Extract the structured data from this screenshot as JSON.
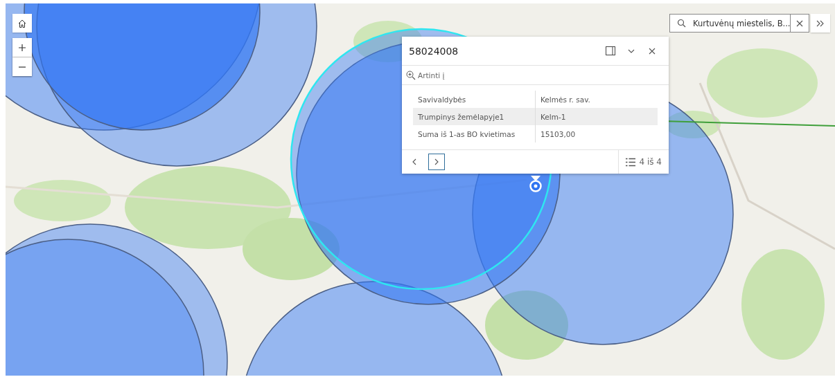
{
  "search": {
    "value": "Kurtuvėnų miestelis, B..."
  },
  "popup": {
    "title": "58024008",
    "action": "Artinti į",
    "fields": [
      {
        "label": "Savivaldybės",
        "value": "Kelmės r. sav.",
        "highlighted": false
      },
      {
        "label": "Trumpinys žemėlapyje1",
        "value": "Kelm-1",
        "highlighted": true
      },
      {
        "label": "Suma iš 1-as BO kvietimas",
        "value": "15103,00",
        "highlighted": false
      }
    ],
    "pager": "4 iš 4"
  }
}
